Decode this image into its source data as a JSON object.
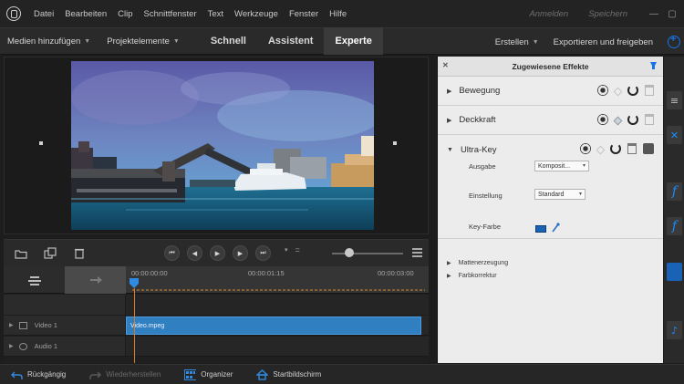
{
  "menu": {
    "items": [
      "Datei",
      "Bearbeiten",
      "Clip",
      "Schnittfenster",
      "Text",
      "Werkzeuge",
      "Fenster",
      "Hilfe"
    ],
    "right_links": [
      "Anmelden",
      "Speichern"
    ]
  },
  "toolbar": {
    "add_media": "Medien hinzufügen",
    "project_assets": "Projektelemente",
    "modes": [
      "Schnell",
      "Assistent",
      "Experte"
    ],
    "active_mode": "Experte",
    "create": "Erstellen",
    "export_share": "Exportieren und freigeben"
  },
  "timeline": {
    "timecodes": [
      "00:00:00:00",
      "00:00:01:15",
      "00:00:03:00"
    ],
    "tracks": [
      {
        "name": "Video 1",
        "kind": "video",
        "clip": "Video.mpeg"
      },
      {
        "name": "Audio 1",
        "kind": "audio",
        "clip": ""
      }
    ]
  },
  "effects_panel": {
    "title": "Zugewiesene Effekte",
    "effects": [
      {
        "name": "Bewegung",
        "expanded": false
      },
      {
        "name": "Deckkraft",
        "expanded": false
      },
      {
        "name": "Ultra-Key",
        "expanded": true
      }
    ],
    "ultra_key": {
      "output_label": "Ausgabe",
      "output_value": "Komposit...",
      "setting_label": "Einstellung",
      "setting_value": "Standard",
      "key_color_label": "Key-Farbe",
      "key_color": "#1a62b5",
      "subgroups": [
        "Mattenerzeugung",
        "Farbkorrektur"
      ]
    }
  },
  "statusbar": {
    "undo": "Rückgängig",
    "redo": "Wiederherstellen",
    "organizer": "Organizer",
    "home": "Startbildschirm"
  }
}
